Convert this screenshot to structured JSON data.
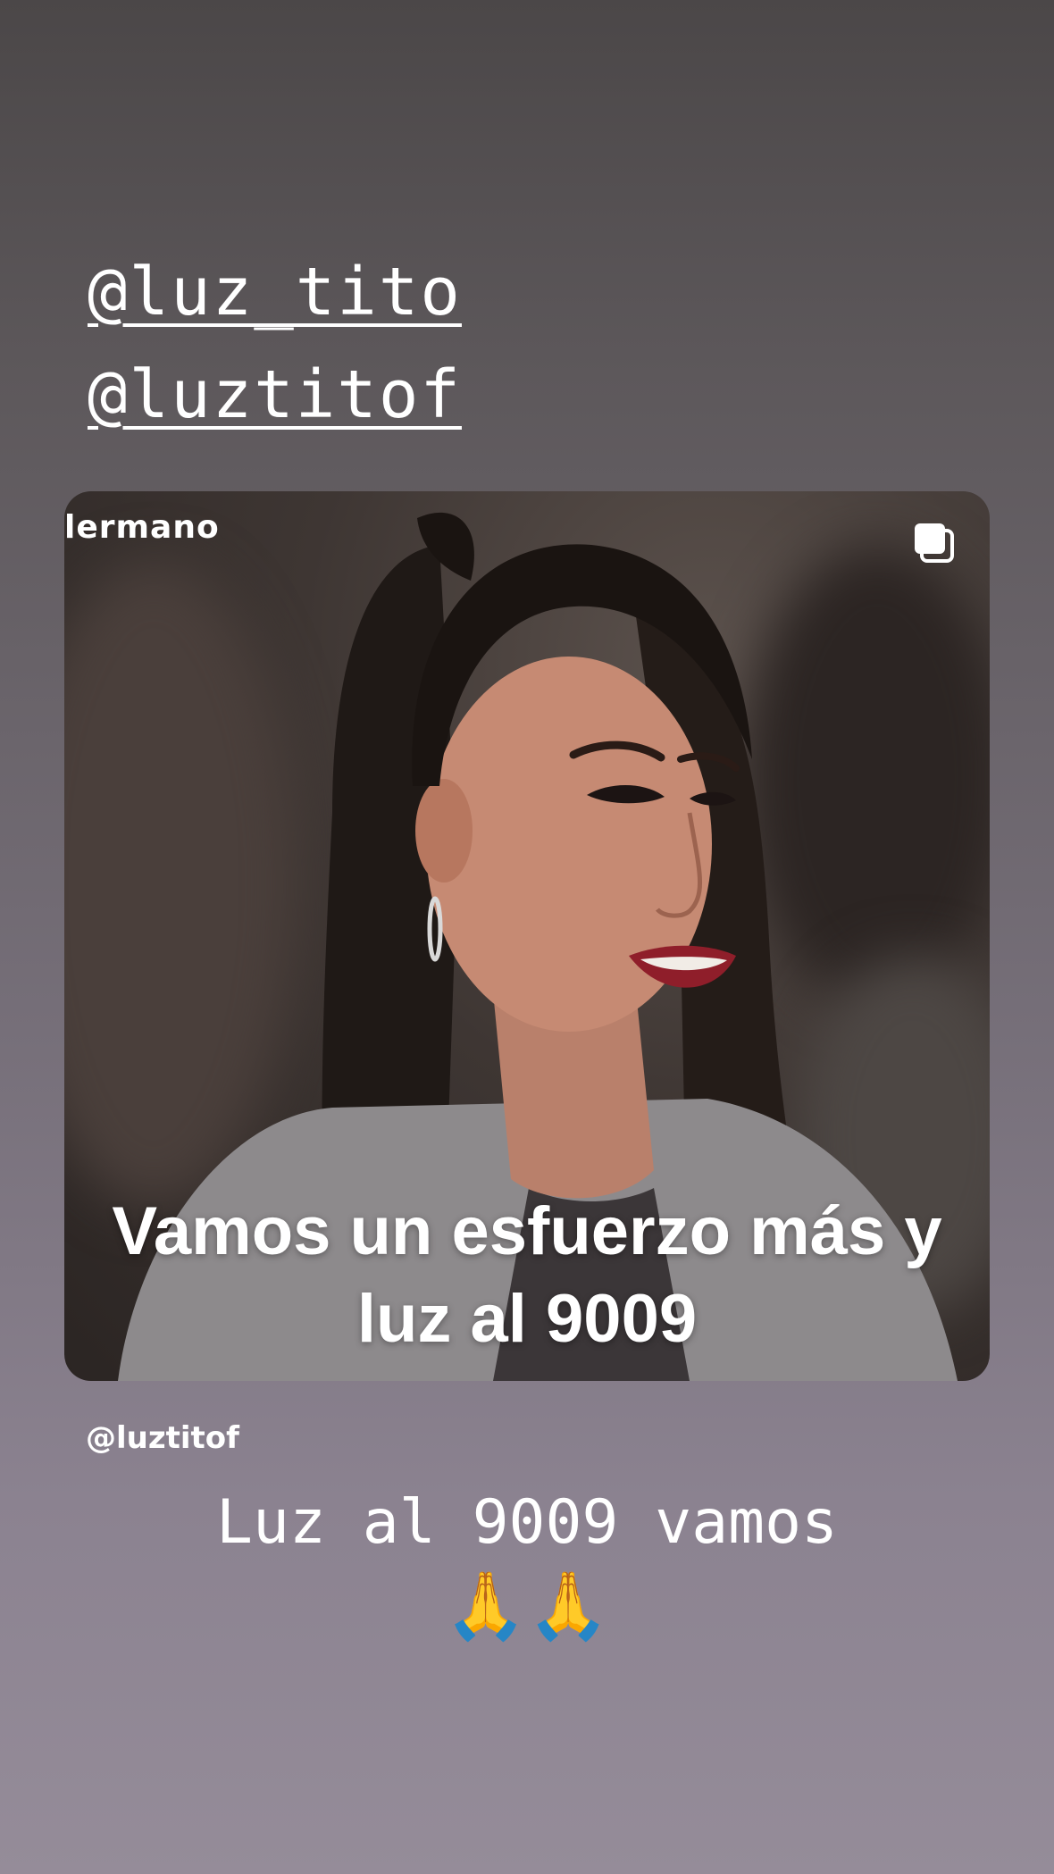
{
  "mentions": [
    "@luz_tito",
    "@luztitof"
  ],
  "post": {
    "watermark": "lermano",
    "caption_line1": "Vamos un esfuerzo más y",
    "caption_line2": "luz al 9009",
    "multi_icon": "multiple-posts-icon",
    "account": "@luztitof"
  },
  "story": {
    "text": "Luz al 9009 vamos",
    "emoji": "🙏🙏"
  }
}
